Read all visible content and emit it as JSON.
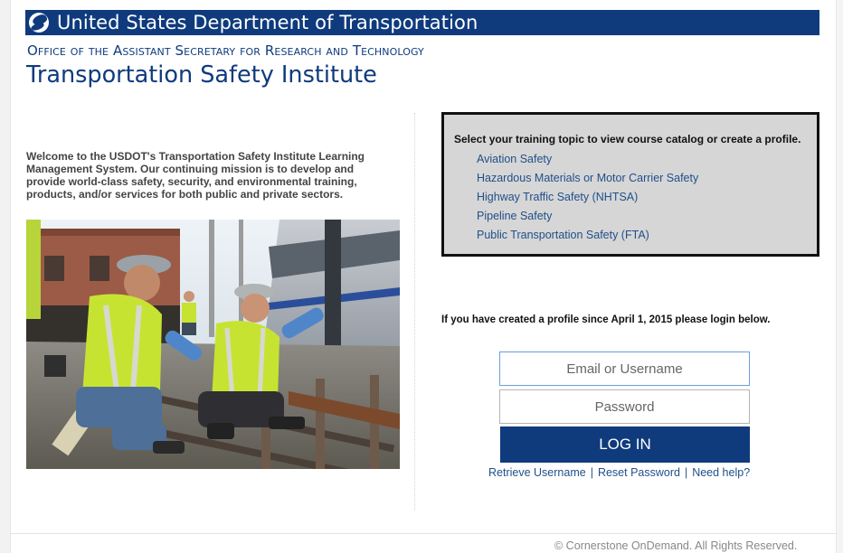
{
  "header": {
    "department": "United States Department of Transportation",
    "office": "Office of the Assistant Secretary for Research and Technology",
    "institute": "Transportation Safety Institute"
  },
  "welcome_text": "Welcome to the USDOT's Transportation Safety Institute Learning Management System. Our continuing mission is to develop and provide world-class safety, security, and environmental training, products, and/or services for both public and private sectors.",
  "topics": {
    "heading": "Select your training topic to view course catalog or create a profile.",
    "items": [
      "Aviation Safety",
      "Hazardous Materials or Motor Carrier Safety",
      "Highway Traffic Safety (NHTSA)",
      "Pipeline Safety",
      "Public Transportation Safety (FTA)"
    ]
  },
  "login": {
    "note": "If you have created a profile since April 1, 2015 please login below.",
    "email_placeholder": "Email or Username",
    "password_placeholder": "Password",
    "button_label": "Log In",
    "links": {
      "retrieve_username": "Retrieve Username",
      "reset_password": "Reset Password",
      "need_help": "Need help?",
      "separator": "|"
    }
  },
  "footer": {
    "copyright": "© Cornerstone OnDemand. All Rights Reserved."
  },
  "colors": {
    "brand_navy": "#0f3b7d",
    "link_blue": "#1f4f8a",
    "topic_box_bg": "#d6d6d6"
  }
}
